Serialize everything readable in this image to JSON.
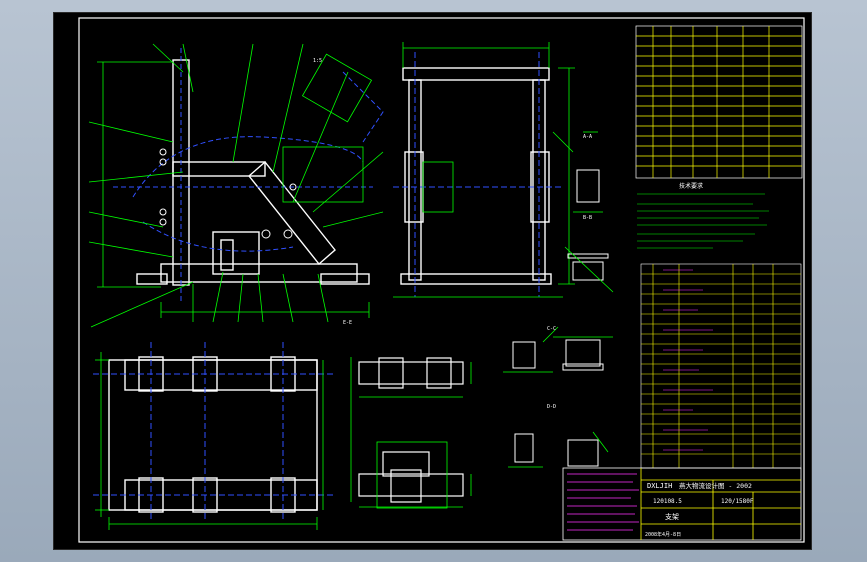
{
  "app": {
    "background_color": "#a6b4c4",
    "model_space_color": "#000000"
  },
  "drawing": {
    "title_block": {
      "school_name": "DXLJIH",
      "project_title": "燕大物流设计图 - 2002",
      "drawing_no": "120108.5",
      "scale_code": "120/1580F",
      "part_name": "支架",
      "date_note": "2008年4月-8日"
    },
    "section_labels": [
      "A-A",
      "B-B",
      "C-C",
      "D-D",
      "E-E",
      "1:5"
    ],
    "tech_requirements_heading": "技术要求",
    "colors": {
      "border": "#ffffff",
      "outline": "#ffffff",
      "dimension": "#00ff00",
      "centerline": "#3050ff",
      "hidden": "#3050ff",
      "table_yellow": "#ffff00",
      "table_magenta": "#ff33ff",
      "text": "#ffffff"
    }
  }
}
